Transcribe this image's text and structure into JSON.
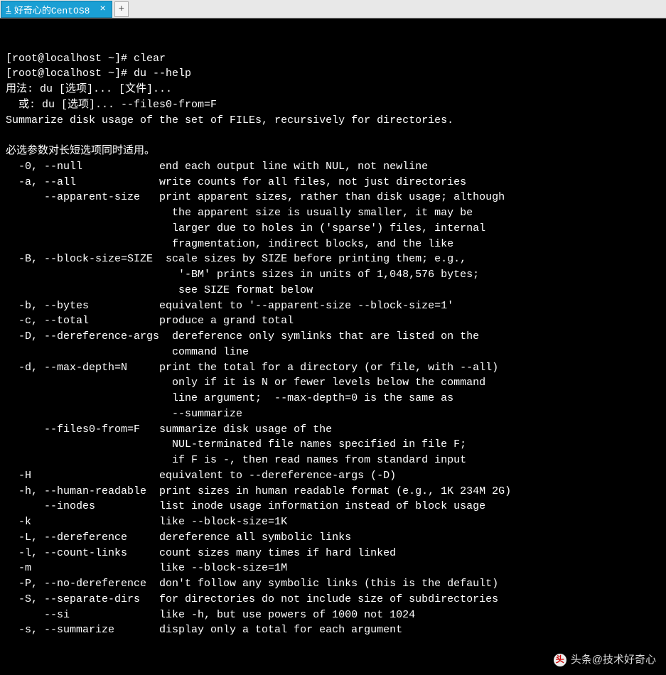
{
  "tab": {
    "number": "1",
    "title": "好奇心的CentOS8",
    "close": "×",
    "add": "+"
  },
  "lines": [
    "[root@localhost ~]# clear",
    "[root@localhost ~]# du --help",
    "用法: du [选项]... [文件]...",
    "  或: du [选项]... --files0-from=F",
    "Summarize disk usage of the set of FILEs, recursively for directories.",
    "",
    "必选参数对长短选项同时适用。",
    "  -0, --null            end each output line with NUL, not newline",
    "  -a, --all             write counts for all files, not just directories",
    "      --apparent-size   print apparent sizes, rather than disk usage; although",
    "                          the apparent size is usually smaller, it may be",
    "                          larger due to holes in ('sparse') files, internal",
    "                          fragmentation, indirect blocks, and the like",
    "  -B, --block-size=SIZE  scale sizes by SIZE before printing them; e.g.,",
    "                           '-BM' prints sizes in units of 1,048,576 bytes;",
    "                           see SIZE format below",
    "  -b, --bytes           equivalent to '--apparent-size --block-size=1'",
    "  -c, --total           produce a grand total",
    "  -D, --dereference-args  dereference only symlinks that are listed on the",
    "                          command line",
    "  -d, --max-depth=N     print the total for a directory (or file, with --all)",
    "                          only if it is N or fewer levels below the command",
    "                          line argument;  --max-depth=0 is the same as",
    "                          --summarize",
    "      --files0-from=F   summarize disk usage of the",
    "                          NUL-terminated file names specified in file F;",
    "                          if F is -, then read names from standard input",
    "  -H                    equivalent to --dereference-args (-D)",
    "  -h, --human-readable  print sizes in human readable format (e.g., 1K 234M 2G)",
    "      --inodes          list inode usage information instead of block usage",
    "  -k                    like --block-size=1K",
    "  -L, --dereference     dereference all symbolic links",
    "  -l, --count-links     count sizes many times if hard linked",
    "  -m                    like --block-size=1M",
    "  -P, --no-dereference  don't follow any symbolic links (this is the default)",
    "  -S, --separate-dirs   for directories do not include size of subdirectories",
    "      --si              like -h, but use powers of 1000 not 1024",
    "  -s, --summarize       display only a total for each argument"
  ],
  "watermark": {
    "logo": "头",
    "prefix": "头条",
    "author": "@技术好奇心"
  }
}
